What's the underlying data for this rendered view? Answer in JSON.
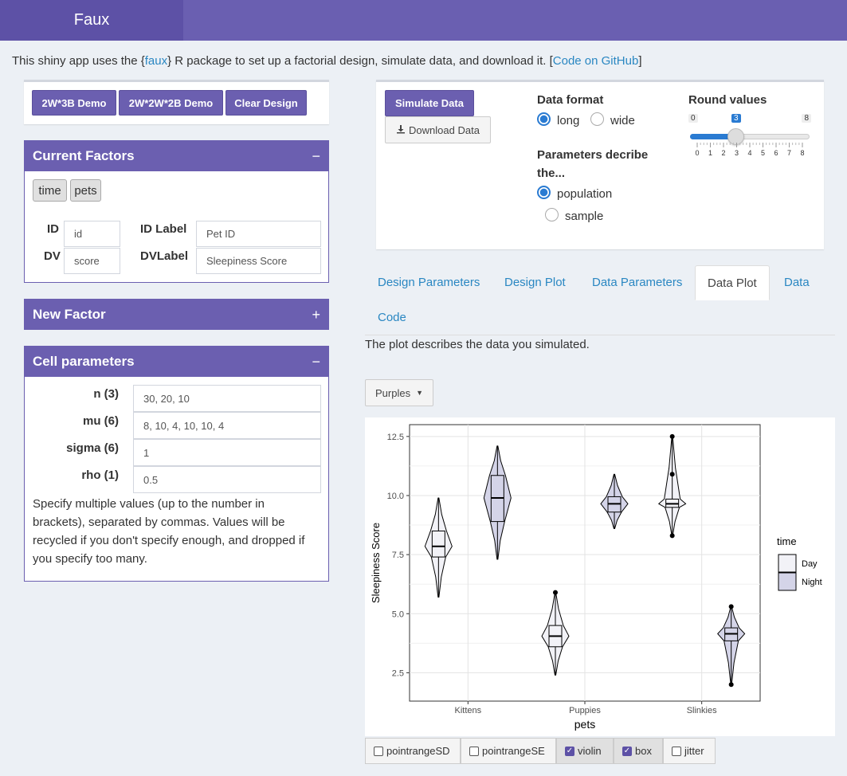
{
  "header": {
    "brand": "Faux"
  },
  "intro": {
    "before": "This shiny app uses the {",
    "pkg_link": "faux",
    "after": "} R package to set up a factorial design, simulate data, and download it. [",
    "github_link": "Code on GitHub",
    "end": "]"
  },
  "demo_buttons": [
    "2W*3B Demo",
    "2W*2W*2B Demo",
    "Clear Design"
  ],
  "current_factors": {
    "title": "Current Factors",
    "collapse": "−",
    "factors": [
      "time",
      "pets"
    ],
    "id_label": "ID",
    "id_value": "id",
    "id_label_label": "ID Label",
    "id_label_value": "Pet ID",
    "dv_label": "DV",
    "dv_value": "score",
    "dv_label_label": "DVLabel",
    "dv_label_value": "Sleepiness Score"
  },
  "new_factor": {
    "title": "New Factor",
    "expand": "+"
  },
  "cell_params": {
    "title": "Cell parameters",
    "collapse": "−",
    "rows": [
      {
        "label": "n (3)",
        "value": "30, 20, 10"
      },
      {
        "label": "mu (6)",
        "value": "8, 10, 4, 10, 10, 4"
      },
      {
        "label": "sigma (6)",
        "value": "1"
      },
      {
        "label": "rho (1)",
        "value": "0.5"
      }
    ],
    "help_lines": [
      "Specify multiple values (up to the number in",
      "brackets), separated by commas. Values will be",
      "recycled if you don't specify enough, and dropped if",
      "you specify too many."
    ]
  },
  "sim": {
    "simulate_label": "Simulate Data",
    "download_label": "Download Data",
    "format_title": "Data format",
    "format_options": [
      "long",
      "wide"
    ],
    "format_selected": "long",
    "params_title_line1": "Parameters decribe",
    "params_title_line2": "the...",
    "params_options": [
      "population",
      "sample"
    ],
    "params_selected": "population",
    "round_title": "Round values",
    "round_min": "0",
    "round_max": "8",
    "round_value": "3",
    "round_ticks": [
      "0",
      "1",
      "2",
      "3",
      "4",
      "5",
      "6",
      "7",
      "8"
    ]
  },
  "tabs": [
    "Design Parameters",
    "Design Plot",
    "Data Parameters",
    "Data Plot",
    "Data",
    "Code"
  ],
  "active_tab": "Data Plot",
  "plot_desc": "The plot describes the data you simulated.",
  "palette_select": "Purples",
  "plot_options": [
    {
      "label": "pointrangeSD",
      "checked": false
    },
    {
      "label": "pointrangeSE",
      "checked": false
    },
    {
      "label": "violin",
      "checked": true
    },
    {
      "label": "box",
      "checked": true
    },
    {
      "label": "jitter",
      "checked": false
    }
  ],
  "chart_data": {
    "type": "violin",
    "xlabel": "pets",
    "ylabel": "Sleepiness Score",
    "categories": [
      "Kittens",
      "Puppies",
      "Slinkies"
    ],
    "ylim": [
      1.3,
      13.0
    ],
    "yticks": [
      "2.5",
      "5.0",
      "7.5",
      "10.0",
      "12.5"
    ],
    "legend_title": "time",
    "legend_position": "right",
    "colors": {
      "Day": "#f2f2f7",
      "Night": "#d4d4e8"
    },
    "series": [
      {
        "name": "Day",
        "groups": [
          {
            "category": "Kittens",
            "min": 5.7,
            "q1": 7.4,
            "median": 7.85,
            "q3": 8.5,
            "max": 9.9
          },
          {
            "category": "Puppies",
            "min": 2.4,
            "q1": 3.6,
            "median": 4.05,
            "q3": 4.5,
            "max": 5.9,
            "outliers": [
              5.9
            ]
          },
          {
            "category": "Slinkies",
            "min": 8.3,
            "q1": 9.5,
            "median": 9.65,
            "q3": 9.85,
            "max": 12.5,
            "outliers": [
              8.3,
              10.9,
              12.5
            ]
          }
        ]
      },
      {
        "name": "Night",
        "groups": [
          {
            "category": "Kittens",
            "min": 7.3,
            "q1": 8.9,
            "median": 9.9,
            "q3": 10.85,
            "max": 12.1
          },
          {
            "category": "Puppies",
            "min": 8.6,
            "q1": 9.3,
            "median": 9.65,
            "q3": 9.95,
            "max": 10.9
          },
          {
            "category": "Slinkies",
            "min": 2.0,
            "q1": 3.85,
            "median": 4.15,
            "q3": 4.4,
            "max": 5.3,
            "outliers": [
              2.0,
              5.3
            ]
          }
        ]
      }
    ]
  }
}
